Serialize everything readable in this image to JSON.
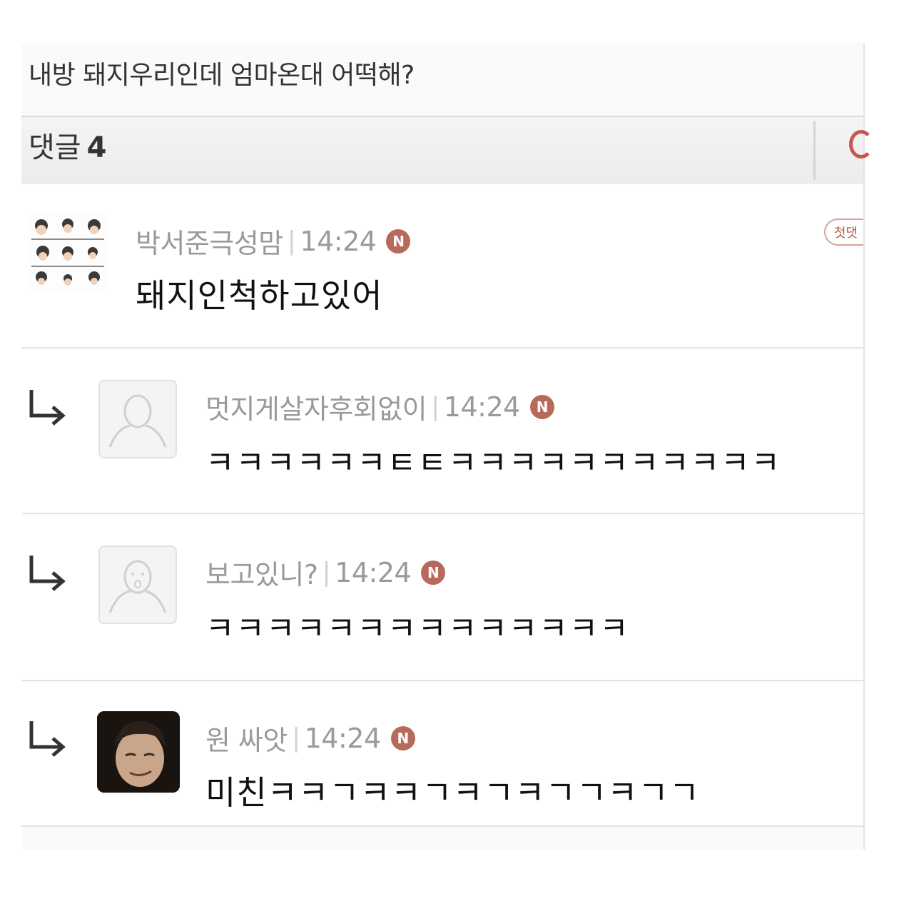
{
  "post": {
    "title": "내방 돼지우리인데 엄마온대 어떡해?"
  },
  "comments_header": {
    "label": "댓글",
    "count": "4"
  },
  "comments": [
    {
      "author": "박서준극성맘",
      "time": "14:24",
      "badge": "N",
      "text": "돼지인척하고있어",
      "tag": "첫댓",
      "avatar": "sticker-grid-avatar"
    },
    {
      "author": "멋지게살자후회없이",
      "time": "14:24",
      "badge": "N",
      "text": "ㅋㅋㅋㅋㅋㅋㅌㅌㅋㅋㅋㅋㅋㅋㅋㅋㅋㅋㅋ",
      "avatar": "default-avatar",
      "reply": true
    },
    {
      "author": "보고있니?",
      "time": "14:24",
      "badge": "N",
      "text": "ㅋㅋㅋㅋㅋㅋㅋㅋㅋㅋㅋㅋㅋㅋ",
      "avatar": "default-avatar",
      "reply": true
    },
    {
      "author": "원 싸앗",
      "time": "14:24",
      "badge": "N",
      "text": "미친ㅋㅋㄱㅋㅋㄱㅋㄱㅋㄱㄱㅋㄱㄱ",
      "avatar": "photo-avatar",
      "reply": true
    }
  ],
  "colors": {
    "new_badge": "#b7695a",
    "accent": "#c8564c"
  }
}
